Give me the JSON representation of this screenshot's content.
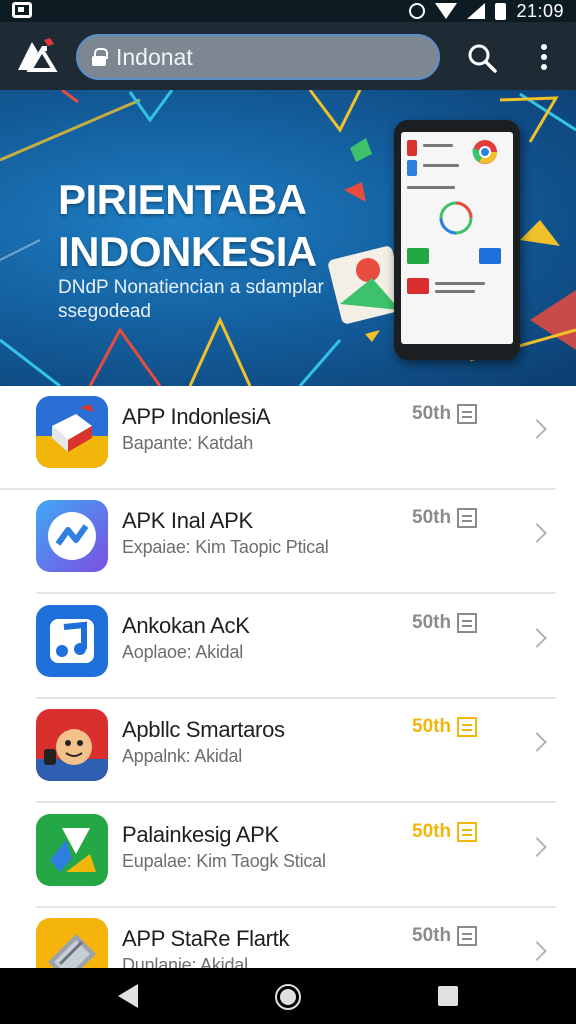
{
  "status_bar": {
    "time": "21:09",
    "icons": [
      "notification-icon",
      "alarm-icon",
      "wifi-icon",
      "signal-icon",
      "battery-icon"
    ]
  },
  "browser": {
    "url_text": "Indonat",
    "icons": [
      "app-logo-icon",
      "lock-icon",
      "search-icon",
      "more-vert-icon"
    ]
  },
  "banner": {
    "title_line1": "PIRIENTABA",
    "title_line2": "INDONKESIA",
    "subtitle": "DNdP Nonatiencian a sdamplar ssegodead"
  },
  "apps": [
    {
      "name": "APP IndonlesiA",
      "desc": "Bapante: Katdah",
      "size": "50th",
      "size_highlight": false,
      "icon_color": "#d9342b"
    },
    {
      "name": "APK Inal APK",
      "desc": "Expaiae: Kim Taopic Ptical",
      "size": "50th",
      "size_highlight": false,
      "icon_color": "#2f7fe0"
    },
    {
      "name": "Ankokan AcK",
      "desc": "Aoplaoe: Akidal",
      "size": "50th",
      "size_highlight": false,
      "icon_color": "#1e6fd9"
    },
    {
      "name": "Apbllc Smartaros",
      "desc": "Appalnk: Akidal",
      "size": "50th",
      "size_highlight": true,
      "icon_color": "#d92f2f"
    },
    {
      "name": "Palainkesig APK",
      "desc": "Eupalae: Kim Taogk Stical",
      "size": "50th",
      "size_highlight": true,
      "icon_color": "#23a845"
    },
    {
      "name": "APP StaRe Flartk",
      "desc": "Dunlanie: Akidal",
      "size": "50th",
      "size_highlight": false,
      "icon_color": "#f4b40c"
    }
  ],
  "nav_bar": {
    "icons": [
      "back-icon",
      "home-icon",
      "recents-icon"
    ]
  }
}
